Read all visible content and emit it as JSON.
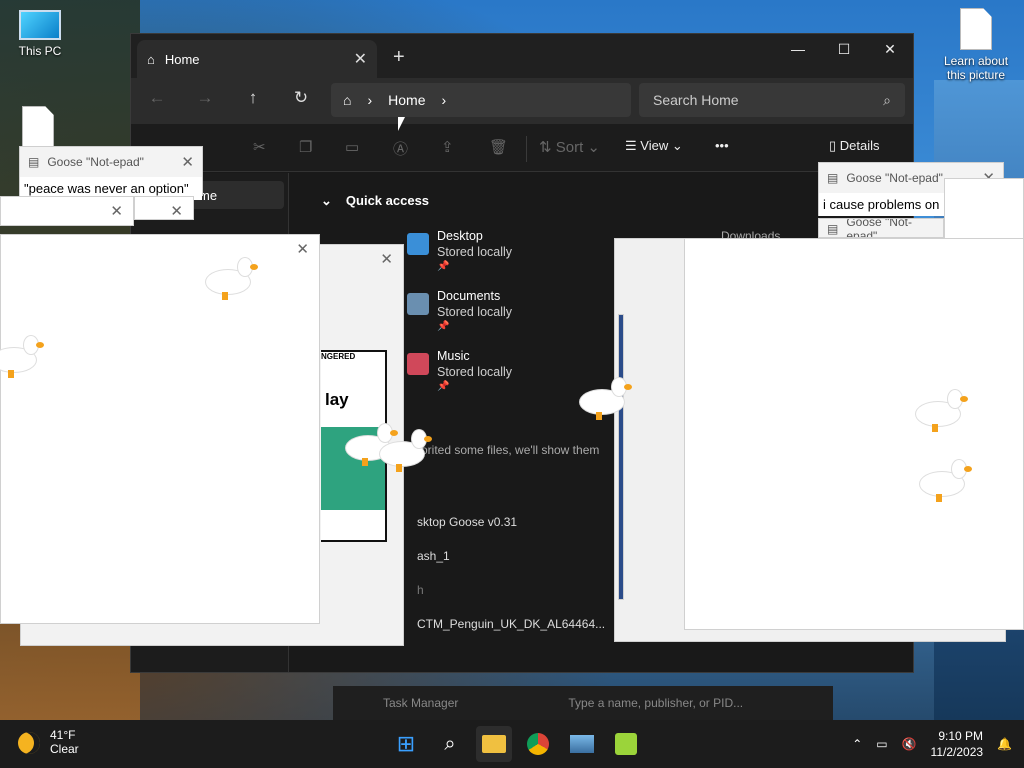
{
  "desktop": {
    "icons": [
      {
        "label": "This PC",
        "icon": "monitor-icon"
      },
      {
        "label": "Learn about this picture",
        "icon": "document-icon"
      }
    ]
  },
  "explorer": {
    "tab_title": "Home",
    "tab_icon": "home-icon",
    "window_controls": [
      "minimize",
      "maximize",
      "close"
    ],
    "address": {
      "root_icon": "home-icon",
      "crumb": "Home"
    },
    "search_placeholder": "Search Home",
    "commands": {
      "sort": "Sort",
      "view": "View",
      "more": "•••",
      "details": "Details"
    },
    "nav_selected": "me",
    "quick_access": "Quick access",
    "folders": [
      {
        "name": "Desktop",
        "status": "Stored locally",
        "color": "#3a8fd8"
      },
      {
        "name": "Documents",
        "status": "Stored locally",
        "color": "#6a8fb0"
      },
      {
        "name": "Music",
        "status": "Stored locally",
        "color": "#d0485a"
      }
    ],
    "downloads_partial": "Downloads",
    "favorites_hint": "orited some files, we'll show them",
    "recent_items": [
      "sktop Goose v0.31",
      "ash_1",
      "h",
      "CTM_Penguin_UK_DK_AL64464..."
    ]
  },
  "notepads": [
    {
      "title": "Goose \"Not-epad\"",
      "text": "\"peace was never an option\""
    },
    {
      "title": "Goose \"Not-epad\"",
      "text": "i cause problems on"
    },
    {
      "title": "Goose \"Not-epad\"",
      "text": ""
    }
  ],
  "comic": {
    "top_text": "NGERED",
    "word": "lay"
  },
  "task_manager": {
    "title": "Task Manager",
    "search_placeholder": "Type a name, publisher, or PID..."
  },
  "taskbar": {
    "weather_temp": "41°F",
    "weather_desc": "Clear",
    "apps": [
      "start-icon",
      "search-icon",
      "file-explorer-icon",
      "chrome-icon",
      "photos-icon",
      "goose-icon"
    ],
    "time": "9:10 PM",
    "date": "11/2/2023"
  }
}
